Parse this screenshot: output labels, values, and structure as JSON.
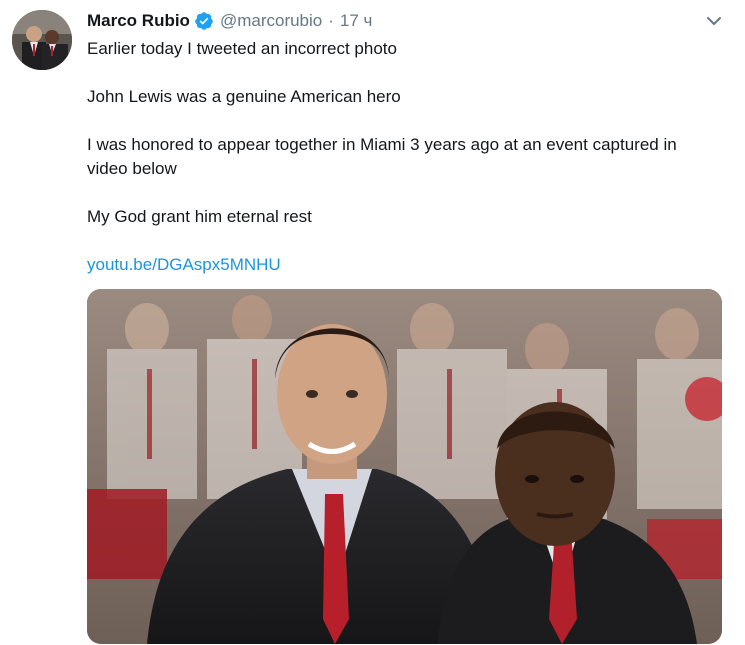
{
  "tweet": {
    "author": {
      "display_name": "Marco Rubio",
      "handle": "@marcorubio",
      "verified": true
    },
    "separator": "·",
    "time": "17 ч",
    "lines": [
      "Earlier today I tweeted an incorrect photo",
      "John Lewis was a genuine American hero",
      "I was honored to appear together in Miami  3 years ago at an event captured in video below",
      "My God grant him eternal rest"
    ],
    "link": "youtu.be/DGAspx5MNHU",
    "icons": {
      "verified": "verified-badge-icon",
      "menu": "chevron-down-icon"
    },
    "colors": {
      "link": "#1b95e0",
      "verified": "#1da1f2",
      "muted": "#657786"
    }
  }
}
